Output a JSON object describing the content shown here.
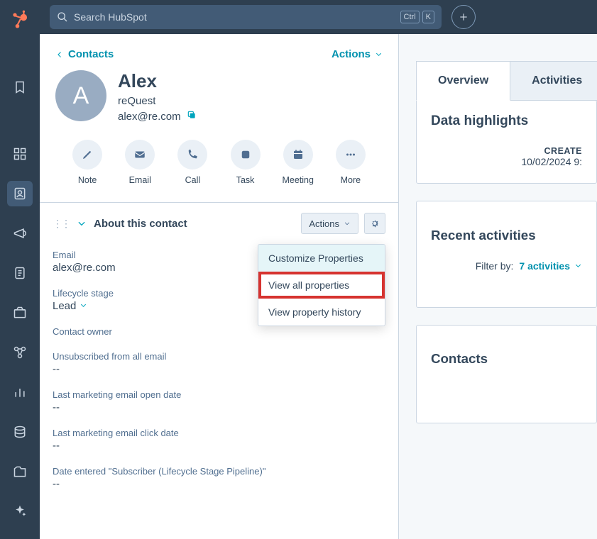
{
  "search": {
    "placeholder": "Search HubSpot",
    "kbd1": "Ctrl",
    "kbd2": "K"
  },
  "back": "Contacts",
  "actions_link": "Actions",
  "contact": {
    "initial": "A",
    "name": "Alex",
    "company": "reQuest",
    "email": "alex@re.com"
  },
  "actbar": {
    "note": "Note",
    "email": "Email",
    "call": "Call",
    "task": "Task",
    "meeting": "Meeting",
    "more": "More"
  },
  "about": {
    "title": "About this contact",
    "actions": "Actions",
    "menu": {
      "customize": "Customize Properties",
      "view_all": "View all properties",
      "history": "View property history"
    }
  },
  "fields": {
    "email_label": "Email",
    "email_value": "alex@re.com",
    "lifecycle_label": "Lifecycle stage",
    "lifecycle_value": "Lead",
    "owner_label": "Contact owner",
    "unsub_label": "Unsubscribed from all email",
    "unsub_value": "--",
    "open_label": "Last marketing email open date",
    "open_value": "--",
    "click_label": "Last marketing email click date",
    "click_value": "--",
    "date_entered_label": "Date entered \"Subscriber (Lifecycle Stage Pipeline)\"",
    "date_entered_value": "--"
  },
  "right": {
    "tab_overview": "Overview",
    "tab_activities": "Activities",
    "highlights_title": "Data highlights",
    "create_label": "CREATE",
    "create_value": "10/02/2024 9:",
    "recent_title": "Recent activities",
    "filter_label": "Filter by:",
    "filter_value": "7 activities",
    "contacts_title": "Contacts"
  }
}
